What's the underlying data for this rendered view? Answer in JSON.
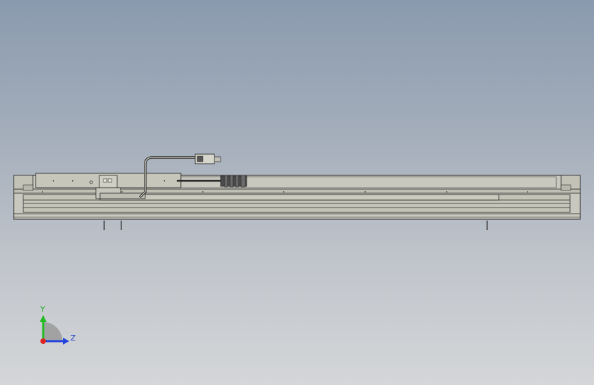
{
  "model": {
    "name": "linear-actuator-side-view",
    "colors": {
      "background_top": "#8a9aae",
      "background_bottom": "#d4d6d8",
      "body_fill": "#c8c8be",
      "body_dark": "#9a9a90",
      "edge": "#2a2a2a",
      "connector": "#555555"
    }
  },
  "triad": {
    "y_label": "Y",
    "z_label": "Z",
    "y_color": "#22bb22",
    "z_color": "#2244dd",
    "x_color": "#dd2222"
  }
}
